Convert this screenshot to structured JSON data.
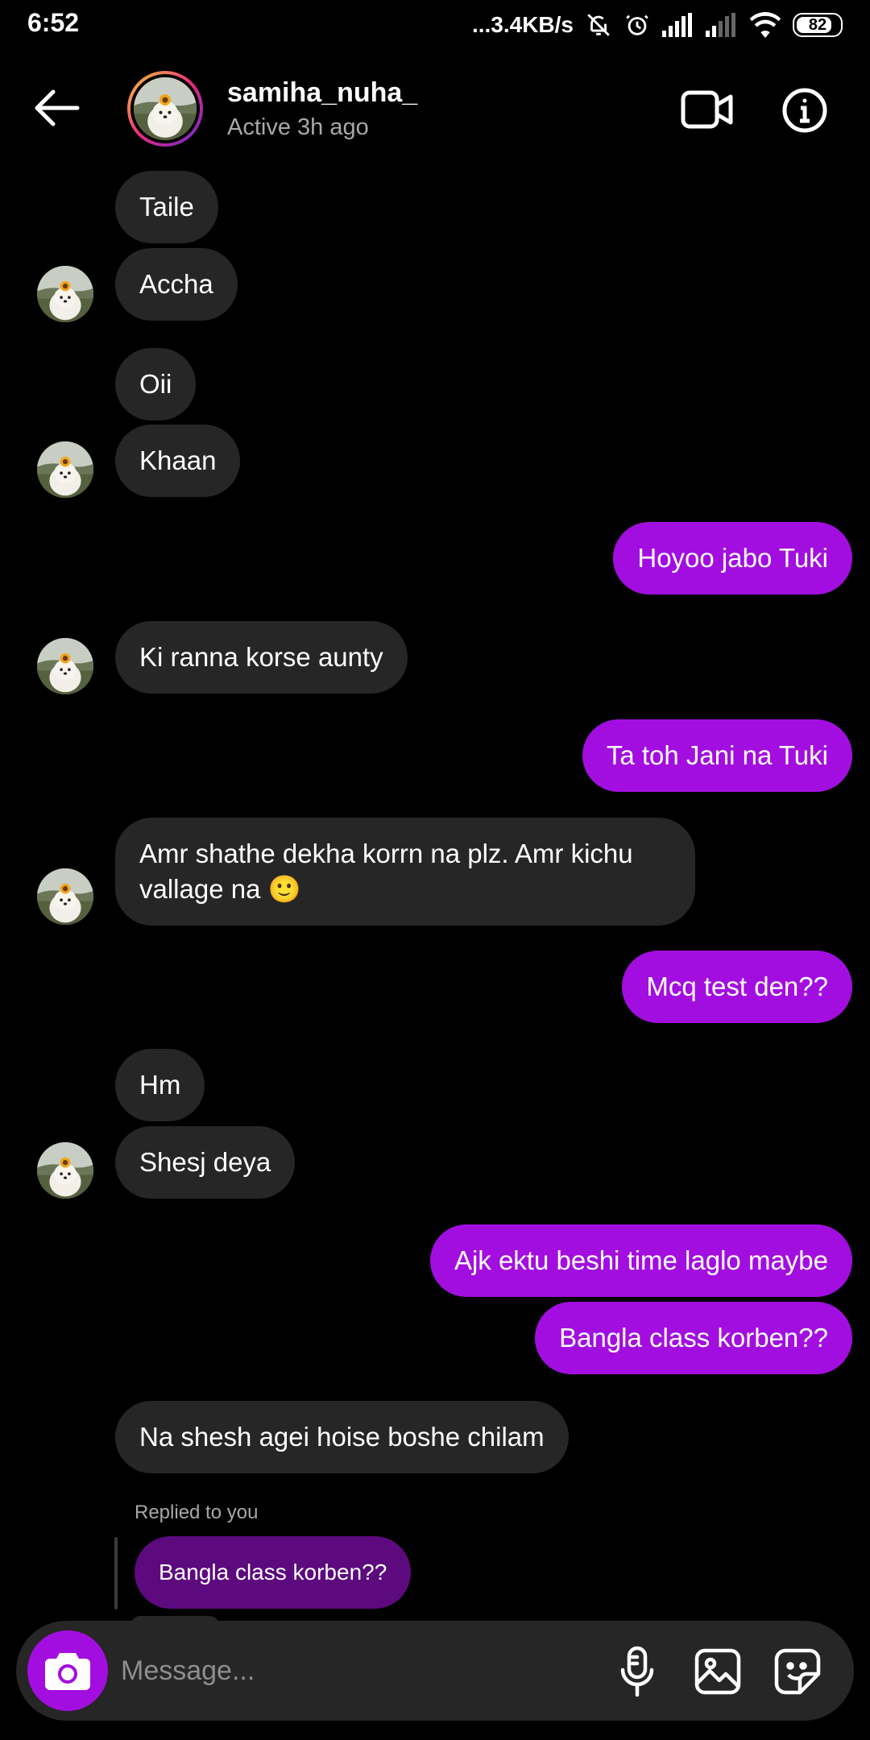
{
  "status_bar": {
    "time": "6:52",
    "network_speed": "...3.4KB/s",
    "battery": "82",
    "battery_level": 0.82,
    "icons": [
      "mute-icon",
      "alarm-icon",
      "signal-icon",
      "signal-weak-icon",
      "wifi-icon",
      "battery-icon"
    ]
  },
  "header": {
    "username": "samiha_nuha_",
    "active_status": "Active 3h ago",
    "icons": [
      "back-arrow-icon",
      "video-call-icon",
      "info-icon"
    ]
  },
  "messages": [
    {
      "side": "in",
      "text": "Taile"
    },
    {
      "side": "in",
      "text": "Accha"
    },
    {
      "side": "in",
      "text": "Oii"
    },
    {
      "side": "in",
      "text": "Khaan"
    },
    {
      "side": "out",
      "text": "Hoyoo jabo Tuki"
    },
    {
      "side": "in",
      "text": "Ki ranna korse aunty"
    },
    {
      "side": "out",
      "text": "Ta toh Jani na Tuki"
    },
    {
      "side": "in",
      "text": "Amr shathe dekha korrn na plz. Amr kichu vallage na 🙂"
    },
    {
      "side": "out",
      "text": "Mcq test den??"
    },
    {
      "side": "in",
      "text": "Hm"
    },
    {
      "side": "in",
      "text": "Shesj deya"
    },
    {
      "side": "out",
      "text": "Ajk ektu beshi time laglo maybe"
    },
    {
      "side": "out",
      "text": "Bangla class korben??"
    },
    {
      "side": "in",
      "text": "Na shesh agei hoise boshe chilam"
    }
  ],
  "reply": {
    "label": "Replied to you",
    "quoted_text": "Bangla class korben??"
  },
  "composer": {
    "placeholder": "Message...",
    "icons": [
      "camera-icon",
      "microphone-icon",
      "gallery-icon",
      "sticker-icon"
    ]
  },
  "colors": {
    "background": "#000000",
    "incoming_bubble": "#262626",
    "outgoing_bubble": "#a30ee0",
    "reply_bubble": "#5c0a7e",
    "secondary_text": "#a8a8a8"
  }
}
